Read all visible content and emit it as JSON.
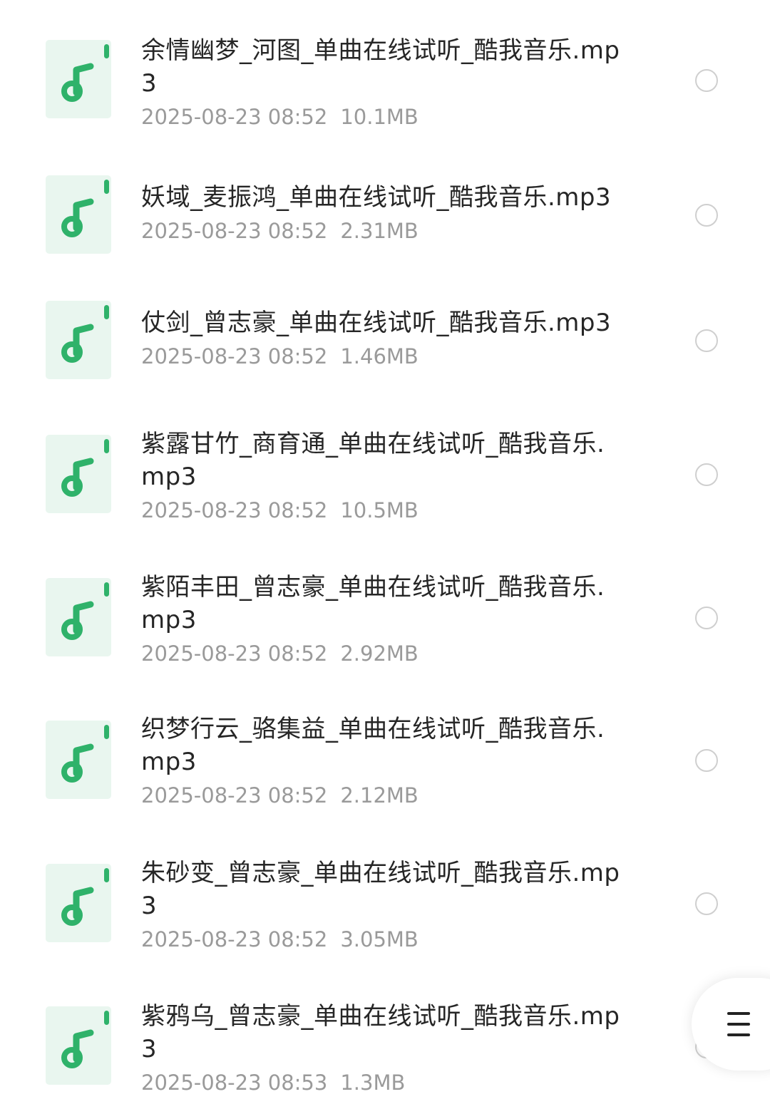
{
  "colors": {
    "icon_green": "#2fb26a",
    "icon_bg": "#e9f6ef",
    "name_text": "#262626",
    "meta_text": "#9a9a9a",
    "radio_border": "#cfcfcf"
  },
  "icons": {
    "file_type": "music-file-icon",
    "row_select": "radio-unchecked-icon",
    "menu": "menu-icon"
  },
  "files": [
    {
      "name": "余情幽梦_河图_单曲在线试听_酷我音乐.mp3",
      "date": "2025-08-23 08:52",
      "size": "10.1MB"
    },
    {
      "name": "妖域_麦振鸿_单曲在线试听_酷我音乐.mp3",
      "date": "2025-08-23 08:52",
      "size": "2.31MB"
    },
    {
      "name": "仗剑_曾志豪_单曲在线试听_酷我音乐.mp3",
      "date": "2025-08-23 08:52",
      "size": "1.46MB"
    },
    {
      "name": "紫露甘竹_商育通_单曲在线试听_酷我音乐.mp3",
      "date": "2025-08-23 08:52",
      "size": "10.5MB"
    },
    {
      "name": "紫陌丰田_曾志豪_单曲在线试听_酷我音乐.mp3",
      "date": "2025-08-23 08:52",
      "size": "2.92MB"
    },
    {
      "name": "织梦行云_骆集益_单曲在线试听_酷我音乐.mp3",
      "date": "2025-08-23 08:52",
      "size": "2.12MB"
    },
    {
      "name": "朱砂变_曾志豪_单曲在线试听_酷我音乐.mp3",
      "date": "2025-08-23 08:52",
      "size": "3.05MB"
    },
    {
      "name": "紫鸦乌_曾志豪_单曲在线试听_酷我音乐.mp3",
      "date": "2025-08-23 08:53",
      "size": "1.3MB"
    }
  ]
}
